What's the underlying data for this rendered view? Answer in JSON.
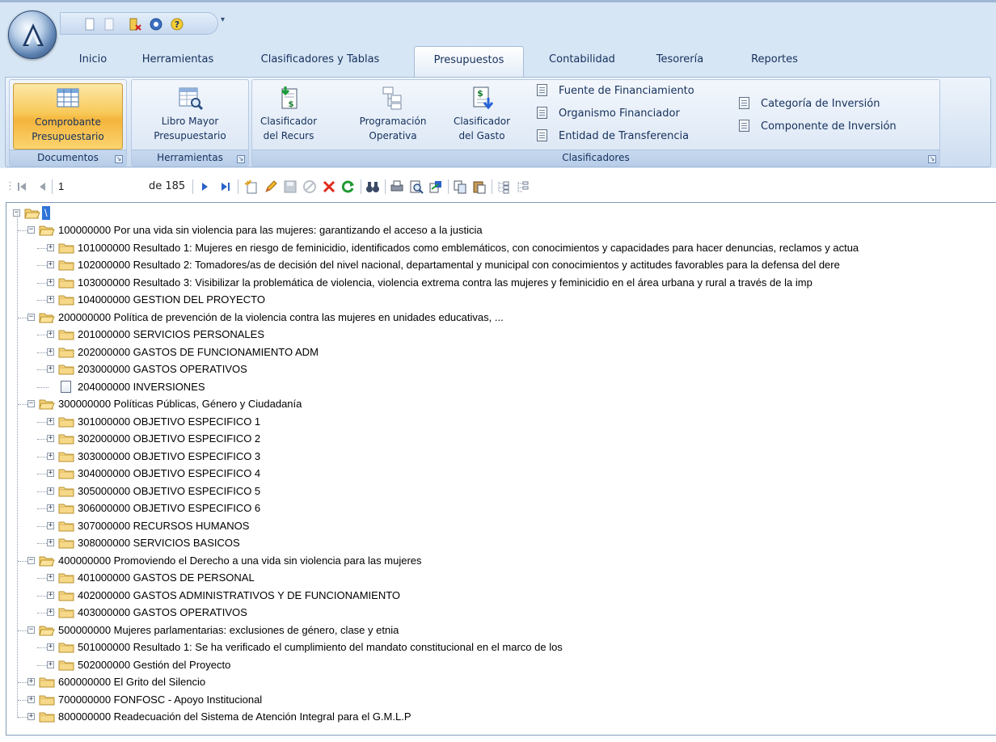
{
  "ribbon": {
    "tabs": [
      {
        "label": "Inicio",
        "active": false
      },
      {
        "label": "Herramientas",
        "active": false
      },
      {
        "label": "Clasificadores y Tablas",
        "active": false
      },
      {
        "label": "Presupuestos",
        "active": true
      },
      {
        "label": "Contabilidad",
        "active": false
      },
      {
        "label": "Tesorería",
        "active": false
      },
      {
        "label": "Reportes",
        "active": false
      }
    ],
    "groups": {
      "documentos": {
        "label": "Documentos",
        "comprobante": {
          "line1": "Comprobante",
          "line2": "Presupuestario",
          "icon": "table-grid-icon"
        }
      },
      "herramientas": {
        "label": "Herramientas",
        "libro_mayor": {
          "line1": "Libro Mayor",
          "line2": "Presupuestario",
          "icon": "ledger-search-icon"
        }
      },
      "clasificadores": {
        "label": "Clasificadores",
        "clasificador_recurs": {
          "line1": "Clasificador",
          "line2": "del Recurs",
          "icon": "document-dollar-icon"
        },
        "programacion": {
          "line1": "Programación",
          "line2": "Operativa",
          "icon": "hierarchy-icon"
        },
        "clasificador_gasto": {
          "line1": "Clasificador",
          "line2": "del Gasto",
          "icon": "document-dollar-down-icon"
        },
        "small": [
          "Fuente de Financiamiento",
          "Organismo Financiador",
          "Entidad de Transferencia",
          "Categoría de Inversión",
          "Componente de Inversión"
        ]
      }
    }
  },
  "navigator": {
    "position": "1",
    "of_total": "de 185"
  },
  "tree": {
    "root_label": "\\",
    "nodes": [
      {
        "text": "100000000 Por una vida sin violencia para las mujeres: garantizando el acceso a la justicia",
        "level": 1,
        "state": "open"
      },
      {
        "text": "101000000 Resultado 1: Mujeres en riesgo de feminicidio, identificados como emblemáticos, con conocimientos y capacidades para hacer denuncias, reclamos y actua",
        "level": 2,
        "state": "closed"
      },
      {
        "text": "102000000 Resultado 2: Tomadores/as  de decisión del nivel nacional, departamental y municipal con conocimientos y actitudes favorables para la defensa del dere",
        "level": 2,
        "state": "closed"
      },
      {
        "text": "103000000 Resultado 3: Visibilizar la problemática de violencia, violencia extrema contra las mujeres y feminicidio en el área urbana y rural a través de la imp",
        "level": 2,
        "state": "closed"
      },
      {
        "text": "104000000 GESTION DEL PROYECTO",
        "level": 2,
        "state": "closed"
      },
      {
        "text": "200000000 Política de prevención de la violencia contra las mujeres en unidades educativas, ...",
        "level": 1,
        "state": "open"
      },
      {
        "text": "201000000 SERVICIOS PERSONALES",
        "level": 2,
        "state": "closed"
      },
      {
        "text": "202000000 GASTOS DE FUNCIONAMIENTO ADM",
        "level": 2,
        "state": "closed"
      },
      {
        "text": "203000000 GASTOS OPERATIVOS",
        "level": 2,
        "state": "closed"
      },
      {
        "text": "204000000 INVERSIONES",
        "level": 2,
        "state": "leaf"
      },
      {
        "text": "300000000 Políticas Públicas, Género y Ciudadanía",
        "level": 1,
        "state": "open"
      },
      {
        "text": "301000000 OBJETIVO ESPECIFICO 1",
        "level": 2,
        "state": "closed"
      },
      {
        "text": "302000000 OBJETIVO ESPECIFICO 2",
        "level": 2,
        "state": "closed"
      },
      {
        "text": "303000000 OBJETIVO ESPECIFICO 3",
        "level": 2,
        "state": "closed"
      },
      {
        "text": "304000000 OBJETIVO ESPECIFICO 4",
        "level": 2,
        "state": "closed"
      },
      {
        "text": "305000000 OBJETIVO ESPECIFICO 5",
        "level": 2,
        "state": "closed"
      },
      {
        "text": "306000000 OBJETIVO ESPECIFICO 6",
        "level": 2,
        "state": "closed"
      },
      {
        "text": "307000000 RECURSOS HUMANOS",
        "level": 2,
        "state": "closed"
      },
      {
        "text": "308000000 SERVICIOS BASICOS",
        "level": 2,
        "state": "closed"
      },
      {
        "text": "400000000 Promoviendo el Derecho a una vida sin violencia para las mujeres",
        "level": 1,
        "state": "open"
      },
      {
        "text": "401000000 GASTOS DE PERSONAL",
        "level": 2,
        "state": "closed"
      },
      {
        "text": "402000000 GASTOS ADMINISTRATIVOS Y DE FUNCIONAMIENTO",
        "level": 2,
        "state": "closed"
      },
      {
        "text": "403000000 GASTOS OPERATIVOS",
        "level": 2,
        "state": "closed"
      },
      {
        "text": "500000000 Mujeres parlamentarias: exclusiones de género, clase y etnia",
        "level": 1,
        "state": "open"
      },
      {
        "text": "501000000 Resultado 1: Se ha verificado el cumplimiento del mandato constitucional en el marco de los",
        "level": 2,
        "state": "closed"
      },
      {
        "text": "502000000 Gestión del Proyecto",
        "level": 2,
        "state": "closed"
      },
      {
        "text": "600000000 El Grito del Silencio",
        "level": 1,
        "state": "closed"
      },
      {
        "text": "700000000 FONFOSC - Apoyo Institucional",
        "level": 1,
        "state": "closed"
      },
      {
        "text": "800000000 Readecuación del Sistema de Atención Integral para el G.M.L.P",
        "level": 1,
        "state": "closed"
      }
    ]
  }
}
